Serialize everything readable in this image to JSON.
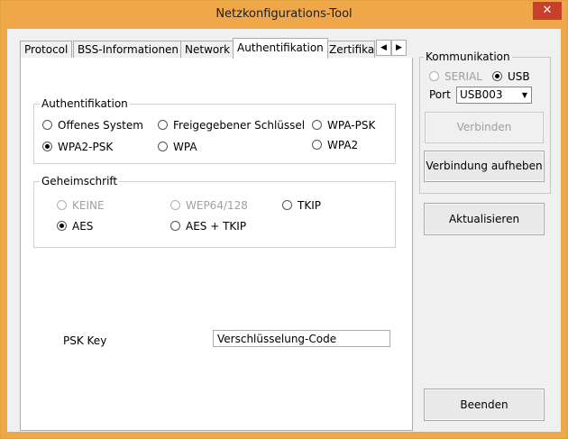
{
  "window": {
    "title": "Netzkonfigurations-Tool",
    "close_symbol": "✕"
  },
  "tabs": [
    {
      "label": "Protocol"
    },
    {
      "label": "BSS-Informationen"
    },
    {
      "label": "Network"
    },
    {
      "label": "Authentifikation",
      "active": true
    },
    {
      "label": "Zertifika"
    }
  ],
  "tab_scroll": {
    "left": "◀",
    "right": "▶"
  },
  "auth_group": {
    "label": "Authentifikation",
    "options": [
      {
        "label": "Offenes System",
        "selected": false
      },
      {
        "label": "Freigegebener Schlüssel",
        "selected": false
      },
      {
        "label": "WPA-PSK",
        "selected": false
      },
      {
        "label": "WPA2-PSK",
        "selected": true
      },
      {
        "label": "WPA",
        "selected": false
      },
      {
        "label": "WPA2",
        "selected": false
      }
    ]
  },
  "cipher_group": {
    "label": "Geheimschrift",
    "options": [
      {
        "label": "KEINE",
        "selected": false,
        "disabled": true
      },
      {
        "label": "WEP64/128",
        "selected": false,
        "disabled": true
      },
      {
        "label": "TKIP",
        "selected": false,
        "disabled": false
      },
      {
        "label": "AES",
        "selected": true,
        "disabled": false
      },
      {
        "label": "AES + TKIP",
        "selected": false,
        "disabled": false
      }
    ]
  },
  "psk": {
    "label": "PSK Key",
    "value": "Verschlüsselung-Code"
  },
  "comm_group": {
    "label": "Kommunikation",
    "options": [
      {
        "label": "SERIAL",
        "selected": false,
        "disabled": true
      },
      {
        "label": "USB",
        "selected": true,
        "disabled": false
      }
    ],
    "port_label": "Port",
    "port_value": "USB003",
    "connect_label": "Verbinden",
    "disconnect_label": "Verbindung aufheben"
  },
  "buttons": {
    "refresh_label": "Aktualisieren",
    "exit_label": "Beenden"
  }
}
